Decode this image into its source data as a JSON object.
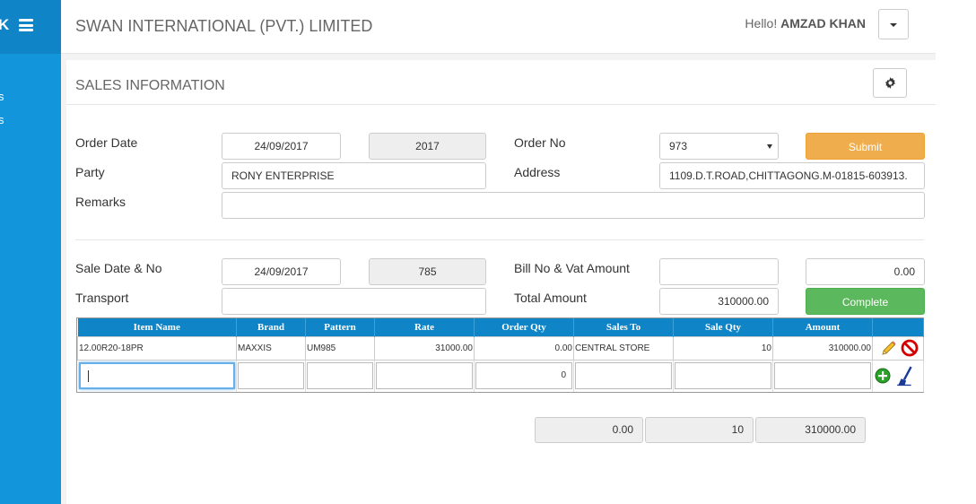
{
  "app": {
    "brand_fragment": "K",
    "sidebar_fragments": [
      "s",
      "s"
    ],
    "company": "SWAN INTERNATIONAL (PVT.) LIMITED",
    "greeting": "Hello!",
    "user": "AMZAD KHAN"
  },
  "page": {
    "title": "SALES INFORMATION"
  },
  "order": {
    "order_date_label": "Order Date",
    "order_date": "24/09/2017",
    "year": "2017",
    "order_no_label": "Order No",
    "order_no": "973",
    "submit_label": "Submit",
    "party_label": "Party",
    "party": "RONY ENTERPRISE",
    "address_label": "Address",
    "address": "1109.D.T.ROAD,CHITTAGONG.M-01815-603913.",
    "remarks_label": "Remarks",
    "remarks": ""
  },
  "sale": {
    "sale_date_label": "Sale Date & No",
    "sale_date": "24/09/2017",
    "sale_no": "785",
    "bill_label": "Bill No & Vat Amount",
    "bill_no": "",
    "vat_amount": "0.00",
    "transport_label": "Transport",
    "transport": "",
    "total_label": "Total Amount",
    "total_amount": "310000.00",
    "complete_label": "Complete"
  },
  "grid": {
    "columns": [
      "Item Name",
      "Brand",
      "Pattern",
      "Rate",
      "Order Qty",
      "Sales To",
      "Sale Qty",
      "Amount"
    ],
    "rows": [
      {
        "item": "12.00R20-18PR",
        "brand": "MAXXIS",
        "pattern": "UM985",
        "rate": "31000.00",
        "order_qty": "0.00",
        "sales_to": "CENTRAL STORE",
        "sale_qty": "10",
        "amount": "310000.00"
      }
    ],
    "entry": {
      "item": "",
      "brand": "",
      "pattern": "",
      "rate": "",
      "order_qty": "0",
      "sales_to": "",
      "sale_qty": "",
      "amount": ""
    }
  },
  "totals": {
    "order_qty": "0.00",
    "sale_qty": "10",
    "amount": "310000.00"
  },
  "colors": {
    "sidebar": "#1395dc",
    "header_grid": "#0f84c7",
    "submit": "#f0ad4e",
    "complete": "#5cb85c"
  },
  "icons": [
    "menu-icon",
    "caret-down-icon",
    "gear-icon",
    "pencil-icon",
    "delete-icon",
    "add-icon",
    "clear-icon"
  ]
}
